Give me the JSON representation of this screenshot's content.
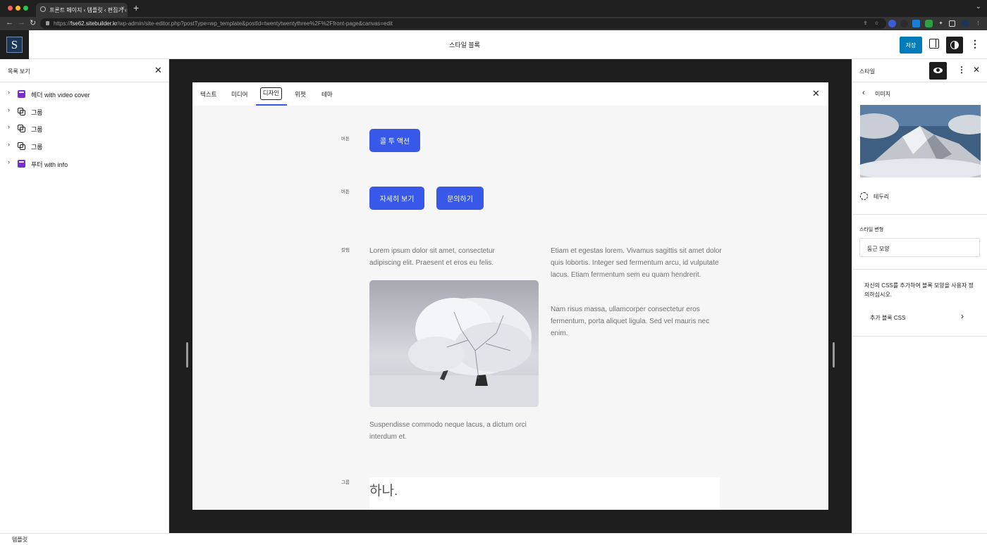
{
  "browser": {
    "tab_title": "프론트 페이지 ‹ 템플릿 ‹ 편집기 ‹ F",
    "url_host": "fse62.sitebuilder.kr",
    "url_prefix": "https://",
    "url_path": "/wp-admin/site-editor.php?postType=wp_template&postId=twentytwentythree%2F%2Ffront-page&canvas=edit"
  },
  "topbar": {
    "site_icon_letter": "S",
    "document_title": "스타일 블록",
    "save_label": "저장"
  },
  "list_view": {
    "title": "목록 보기",
    "items": [
      {
        "label": "헤더 with video cover",
        "icon": "template-part-icon"
      },
      {
        "label": "그룹",
        "icon": "group-icon"
      },
      {
        "label": "그룹",
        "icon": "group-icon"
      },
      {
        "label": "그룹",
        "icon": "group-icon"
      },
      {
        "label": "푸터 with info",
        "icon": "template-part-icon"
      }
    ]
  },
  "style_book": {
    "tabs": [
      "텍스트",
      "미디어",
      "디자인",
      "위젯",
      "테마"
    ],
    "active_tab": "디자인",
    "sections": {
      "buttons1_label": "버튼",
      "buttons1": [
        "콜 투 액션"
      ],
      "buttons2_label": "버튼",
      "buttons2": [
        "자세히 보기",
        "문의하기"
      ],
      "columns_label": "칼럼",
      "col1_text": "Lorem ipsum dolor sit amet, consectetur adipiscing elit. Praesent et eros eu felis.",
      "col1_caption": "Suspendisse commodo neque lacus, a dictum orci interdum et.",
      "col2_text1": "Etiam et egestas lorem. Vivamus sagittis sit amet dolor quis lobortis. Integer sed fermentum arcu, id vulputate lacus. Etiam fermentum sem eu quam hendrerit.",
      "col2_text2": "Nam risus massa, ullamcorper consectetur eros fermentum, porta aliquet ligula. Sed vel mauris nec enim.",
      "group_label": "그룹",
      "group_heading": "하나."
    }
  },
  "styles_panel": {
    "title": "스타일",
    "subtitle": "이미지",
    "border_label": "테두리",
    "variation_label": "스타일 변형",
    "variation_value": "둥근 모양",
    "css_description": "자신의 CSS를 추가하여 블록 모양을 사용자 정의하십시오.",
    "css_label": "추가 블록 CSS"
  },
  "footer": {
    "breadcrumb": "템플릿"
  },
  "colors": {
    "accent": "#3858e9",
    "save": "#007cba",
    "dark": "#1e1e1e"
  }
}
